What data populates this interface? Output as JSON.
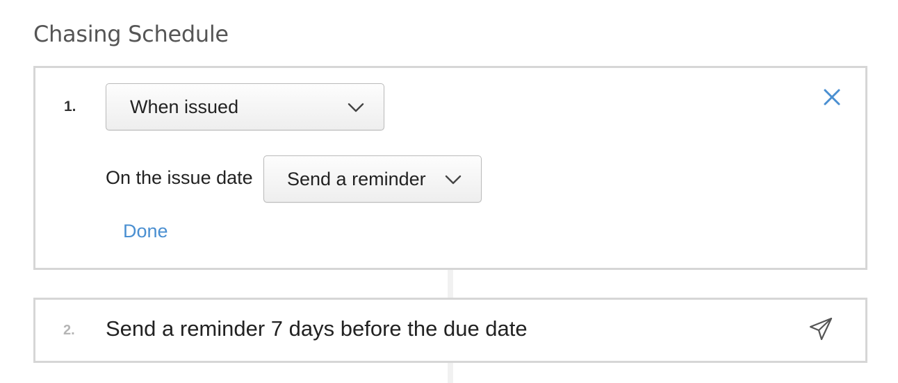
{
  "section": {
    "title": "Chasing Schedule"
  },
  "steps": [
    {
      "number": "1.",
      "trigger_select": {
        "value": "When issued",
        "icon": "chevron-down-icon"
      },
      "timing_label": "On the issue date",
      "action_select": {
        "value": "Send a reminder",
        "icon": "chevron-down-icon"
      },
      "done_label": "Done",
      "close_icon": "close-icon"
    },
    {
      "number": "2.",
      "summary": "Send a reminder 7 days before the due date",
      "action_icon": "paper-plane-icon"
    }
  ],
  "colors": {
    "link": "#4a8fd1",
    "close_icon": "#4a8fd1",
    "card_border": "#d6d6d6",
    "title_text": "#555555",
    "muted_number": "#b5b5b5"
  }
}
